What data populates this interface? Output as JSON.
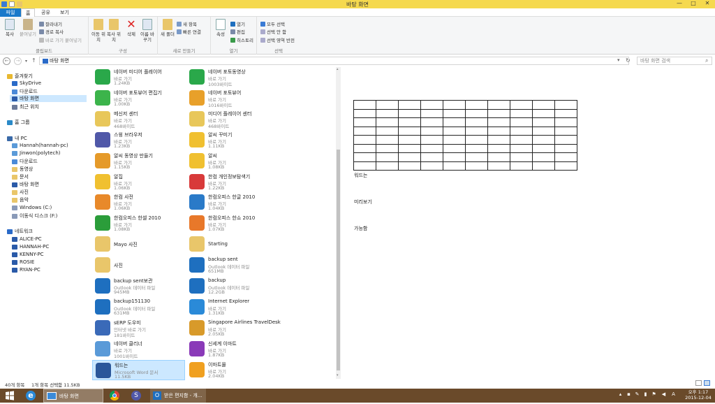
{
  "window": {
    "title": "바탕 화면",
    "minimize": "—",
    "maximize": "□",
    "close": "✕"
  },
  "menu": {
    "file": "파일",
    "home": "홈",
    "share": "공유",
    "view": "보기"
  },
  "ribbon": {
    "clipboard": {
      "label": "클립보드",
      "copy": "복사",
      "paste": "붙여넣기",
      "cut": "잘라내기",
      "copy_path": "경로 복사",
      "paste_shortcut": "바로 가기 붙여넣기"
    },
    "organize": {
      "label": "구성",
      "move_to": "이동 위치",
      "copy_to": "복사 위치",
      "delete": "삭제",
      "rename": "이름 바꾸기"
    },
    "new": {
      "label": "새로 만들기",
      "new_folder": "새 폴더",
      "new_item": "새 항목",
      "easy_access": "빠른 연결"
    },
    "open": {
      "label": "열기",
      "properties": "속성",
      "open": "열기",
      "edit": "편집",
      "history": "히스토리"
    },
    "select": {
      "label": "선택",
      "select_all": "모두 선택",
      "select_none": "선택 안 함",
      "invert": "선택 영역 반전"
    }
  },
  "address": {
    "path": "바탕 화면",
    "search_placeholder": "바탕 화면 검색"
  },
  "nav": {
    "favorites": "즐겨찾기",
    "skydrive": "SkyDrive",
    "downloads": "다운로드",
    "desktop": "바탕 화면",
    "recent": "최근 위치",
    "homegroup": "홈 그룹",
    "pc": "내 PC",
    "pc1": "Hannah(hannah-pc)",
    "pc2": "Jinwon(polytech)",
    "pc_downloads": "다운로드",
    "videos": "동영상",
    "documents": "문서",
    "pc_desktop": "바탕 화면",
    "pictures": "사진",
    "music": "음악",
    "drive_c": "Windows (C:)",
    "drive_f": "이동식 디스크 (F:)",
    "network": "네트워크",
    "n1": "ALICE-PC",
    "n2": "HANNAH-PC",
    "n3": "KENNY-PC",
    "n4": "ROSIE",
    "n5": "RYAN-PC"
  },
  "files": {
    "col1": [
      {
        "name": "네이버 미디어 플레이어",
        "type": "바로 가기",
        "size": "1.24KB",
        "color": "#2aa84a"
      },
      {
        "name": "네이버 포토뷰어 편집기",
        "type": "바로 가기",
        "size": "1.00KB",
        "color": "#3cb44b"
      },
      {
        "name": "메신저 센터",
        "type": "바로 가기",
        "size": "468바이트",
        "color": "#e8c75a"
      },
      {
        "name": "스윙 브라우저",
        "type": "바로 가기",
        "size": "1.23KB",
        "color": "#5058a8"
      },
      {
        "name": "알씨 동영상 만들기",
        "type": "바로 가기",
        "size": "1.15KB",
        "color": "#e59a2a"
      },
      {
        "name": "알집",
        "type": "바로 가기",
        "size": "1.06KB",
        "color": "#f0c030"
      },
      {
        "name": "한컴 사전",
        "type": "바로 가기",
        "size": "1.06KB",
        "color": "#e8892a"
      },
      {
        "name": "한컴오피스 한셀 2010",
        "type": "바로 가기",
        "size": "1.08KB",
        "color": "#2b9d3a"
      },
      {
        "name": "Mayo 사진",
        "type": "",
        "size": "",
        "color": "#e9c66a"
      },
      {
        "name": "사진",
        "type": "",
        "size": "",
        "color": "#e9c66a"
      },
      {
        "name": "backup sent보관",
        "type": "Outlook 데이터 파일",
        "size": "945MB",
        "color": "#1e6fbf"
      },
      {
        "name": "backup151130",
        "type": "Outlook 데이터 파일",
        "size": "631MB",
        "color": "#1e6fbf"
      },
      {
        "name": "sERP 도우미",
        "type": "인터넷 바로 가기",
        "size": "181바이트",
        "color": "#3a6ab8"
      },
      {
        "name": "네이버 클리너",
        "type": "바로 가기",
        "size": "1001바이트",
        "color": "#5a9ad8"
      },
      {
        "name": "워드는",
        "type": "Microsoft Word 문서",
        "size": "11.5KB",
        "color": "#2b579a"
      }
    ],
    "col2": [
      {
        "name": "네이버 포토동영상",
        "type": "바로 가기",
        "size": "1003바이트",
        "color": "#2aa84a"
      },
      {
        "name": "네이버 포토뷰어",
        "type": "바로 가기",
        "size": "1016바이트",
        "color": "#e8a02a"
      },
      {
        "name": "미디어 플레이어 센터",
        "type": "바로 가기",
        "size": "468바이트",
        "color": "#e8c75a"
      },
      {
        "name": "알씨 꾸미기",
        "type": "바로 가기",
        "size": "1.11KB",
        "color": "#f0c030"
      },
      {
        "name": "알씨",
        "type": "바로 가기",
        "size": "1.08KB",
        "color": "#f0c030"
      },
      {
        "name": "한컴 개인정보탐색기",
        "type": "바로 가기",
        "size": "1.22KB",
        "color": "#d83a3a"
      },
      {
        "name": "한컴오피스 한글 2010",
        "type": "바로 가기",
        "size": "1.04KB",
        "color": "#2a7ac8"
      },
      {
        "name": "한컴오피스 한쇼 2010",
        "type": "바로 가기",
        "size": "1.07KB",
        "color": "#e8782a"
      },
      {
        "name": "Starting",
        "type": "",
        "size": "",
        "color": "#e9c66a"
      },
      {
        "name": "backup sent",
        "type": "Outlook 데이터 파일",
        "size": "651MB",
        "color": "#1e6fbf"
      },
      {
        "name": "backup",
        "type": "Outlook 데이터 파일",
        "size": "12.2GB",
        "color": "#1e6fbf"
      },
      {
        "name": "Internet Explorer",
        "type": "바로 가기",
        "size": "1.31KB",
        "color": "#2a8ad8"
      },
      {
        "name": "Singapore Airlines TravelDesk",
        "type": "바로 가기",
        "size": "2.05KB",
        "color": "#d89a2a"
      },
      {
        "name": "신세계 이마트",
        "type": "바로 가기",
        "size": "1.87KB",
        "color": "#8a3ab8"
      },
      {
        "name": "이마트몰",
        "type": "바로 가기",
        "size": "2.04KB",
        "color": "#f0a020"
      }
    ]
  },
  "preview": {
    "line1": "워드는",
    "line2": "미리보기",
    "line3": "가능함",
    "rows": 8,
    "cols": 10
  },
  "status": {
    "count": "40개 항목",
    "selected": "1개 항목 선택함 11.5KB"
  },
  "taskbar": {
    "explorer": "바탕 화면",
    "outlook": "받은 편지함 - 개...",
    "time": "오후 1:17",
    "date": "2015-12-04",
    "ime": "A"
  }
}
